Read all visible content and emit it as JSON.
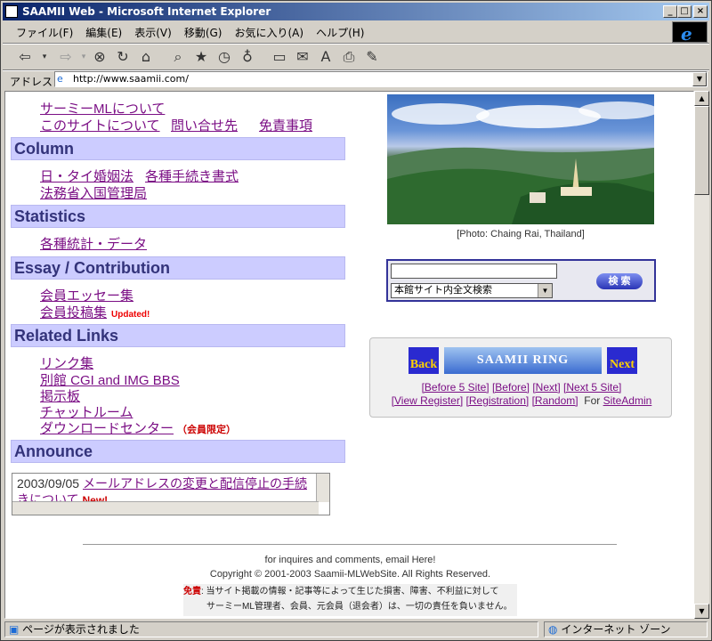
{
  "window": {
    "title": "SAAMII Web - Microsoft Internet Explorer"
  },
  "menu": [
    "ファイル(F)",
    "編集(E)",
    "表示(V)",
    "移動(G)",
    "お気に入り(A)",
    "ヘルプ(H)"
  ],
  "address": {
    "label": "アドレス",
    "url": "http://www.saamii.com/"
  },
  "page": {
    "top_links": [
      "サーミーMLについて",
      "このサイトについて",
      "問い合せ先",
      "免責事項"
    ],
    "sections": {
      "column": {
        "title": "Column",
        "links": [
          "日・タイ婚姻法",
          "各種手続き書式",
          "法務省入国管理局"
        ]
      },
      "statistics": {
        "title": "Statistics",
        "links": [
          "各種統計・データ"
        ]
      },
      "essay": {
        "title": "Essay / Contribution",
        "links": [
          "会員エッセー集",
          "会員投稿集"
        ],
        "updated_badge": "Updated!"
      },
      "related": {
        "title": "Related Links",
        "links": [
          "リンク集",
          "別館 CGI and IMG BBS",
          "掲示板",
          "チャットルーム",
          "ダウンロードセンター"
        ],
        "members_only": "（会員限定）"
      },
      "announce": {
        "title": "Announce",
        "date": "2003/09/05",
        "text": "メールアドレスの変更と配信停止の手続きについて",
        "new_badge": "New!"
      }
    },
    "photo_caption": "[Photo: Chaing Rai, Thailand]",
    "search": {
      "select_value": "本館サイト内全文検索",
      "button": "検 索"
    },
    "ring": {
      "back": "Back",
      "center": "SAAMII RING",
      "next": "Next",
      "row1": [
        "[Before 5 Site]",
        "[Before]",
        "[Next]",
        "[Next 5 Site]"
      ],
      "row2": [
        "[View Register]",
        "[Registration]",
        "[Random]"
      ],
      "for_label": "For",
      "site_admin": "SiteAdmin"
    },
    "footer": {
      "inquiries": "for inquires and comments, email Here!",
      "copyright": "Copyright © 2001-2003 Saamii-MLWebSite. All Rights Reserved.",
      "disclaimer_label": "免責",
      "disclaimer_line1": ": 当サイト掲載の情報・記事等によって生じた損害、障害、不利益に対して",
      "disclaimer_line2": "サーミーML管理者、会員、元会員（退会者）は、一切の責任を負いません。"
    }
  },
  "status": {
    "text": "ページが表示されました",
    "zone": "インターネット ゾーン"
  }
}
